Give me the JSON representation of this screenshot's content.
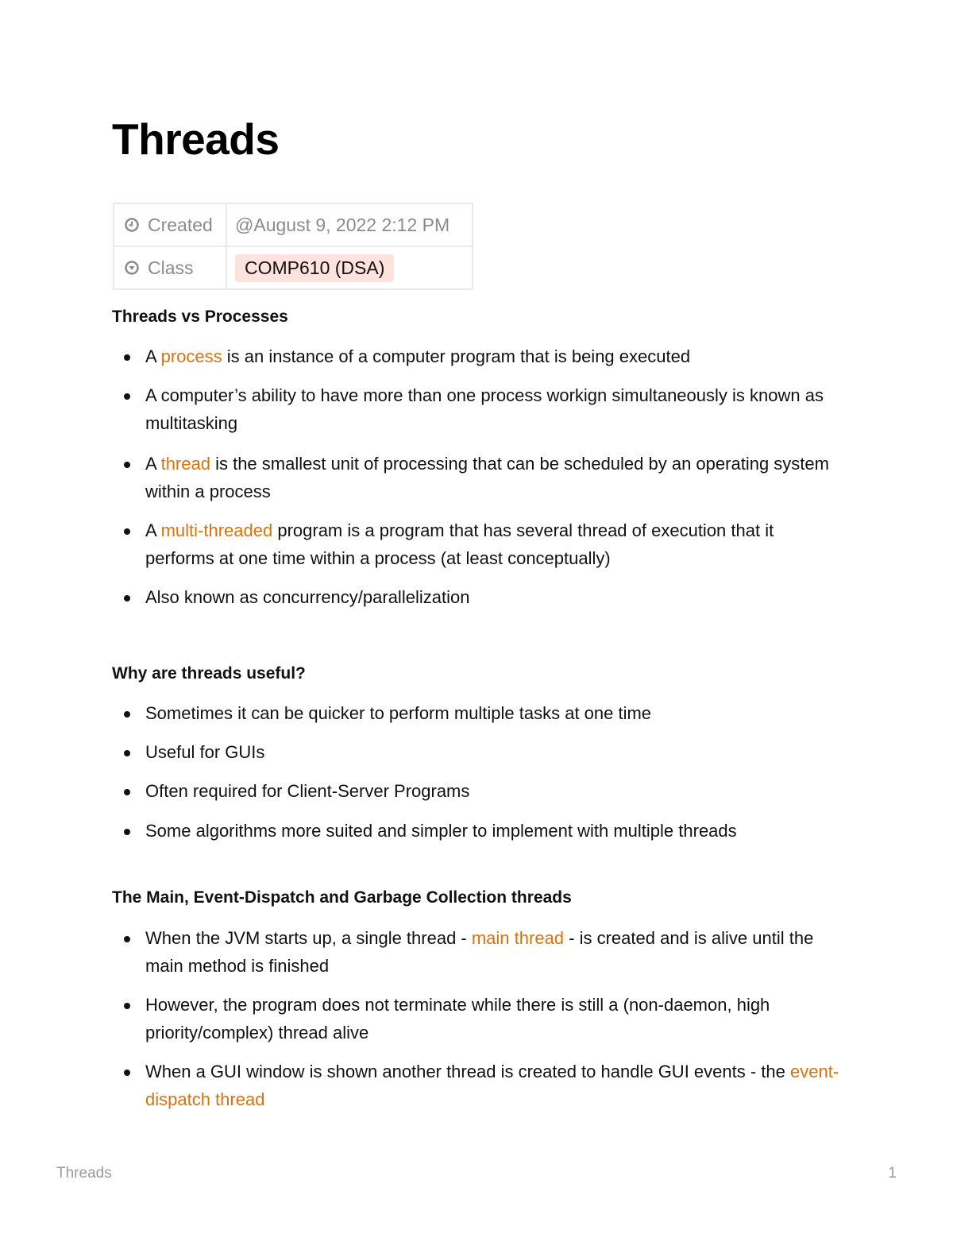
{
  "page": {
    "title": "Threads"
  },
  "properties": {
    "created": {
      "label": "Created",
      "icon": "clock-icon",
      "value": "@August 9, 2022 2:12 PM"
    },
    "class": {
      "label": "Class",
      "icon": "select-icon",
      "value": "COMP610 (DSA)",
      "tag_color": "#fde2dd"
    }
  },
  "accent_color": "#d9730d",
  "sections": [
    {
      "heading": "Threads vs Processes",
      "items": [
        {
          "pre": "A ",
          "hl": "process",
          "post": " is an instance of a computer program that is being executed"
        },
        {
          "pre": "A computer’s ability to have more than one process workign simultaneously is known as multitasking",
          "hl": "",
          "post": ""
        },
        {
          "pre": "A ",
          "hl": "thread",
          "post": " is the smallest unit of processing that can be scheduled by an operating system within a process"
        },
        {
          "pre": "A ",
          "hl": "multi-threaded",
          "post": " program is a program that has several thread of execution that it performs at one time within a process (at least conceptually)"
        },
        {
          "pre": "Also known as concurrency/parallelization",
          "hl": "",
          "post": ""
        }
      ]
    },
    {
      "heading": "Why are threads useful?",
      "items": [
        {
          "pre": "Sometimes it can be quicker to perform multiple tasks at one time",
          "hl": "",
          "post": ""
        },
        {
          "pre": "Useful for GUIs",
          "hl": "",
          "post": ""
        },
        {
          "pre": "Often required for Client-Server Programs",
          "hl": "",
          "post": ""
        },
        {
          "pre": "Some algorithms more suited and simpler to implement with multiple threads",
          "hl": "",
          "post": ""
        }
      ]
    },
    {
      "heading": "The Main, Event-Dispatch and Garbage Collection threads",
      "items": [
        {
          "pre": "When the JVM starts up, a single thread - ",
          "hl": "main thread",
          "post": " - is created and is alive until the main method is finished"
        },
        {
          "pre": "However, the program does not terminate while there is still a (non-daemon, high priority/complex) thread alive",
          "hl": "",
          "post": ""
        },
        {
          "pre": "When a GUI window is shown another thread is created to handle GUI events - the ",
          "hl": "event-dispatch thread",
          "post": ""
        }
      ]
    }
  ],
  "footer": {
    "doc_title": "Threads",
    "page_number": "1"
  }
}
